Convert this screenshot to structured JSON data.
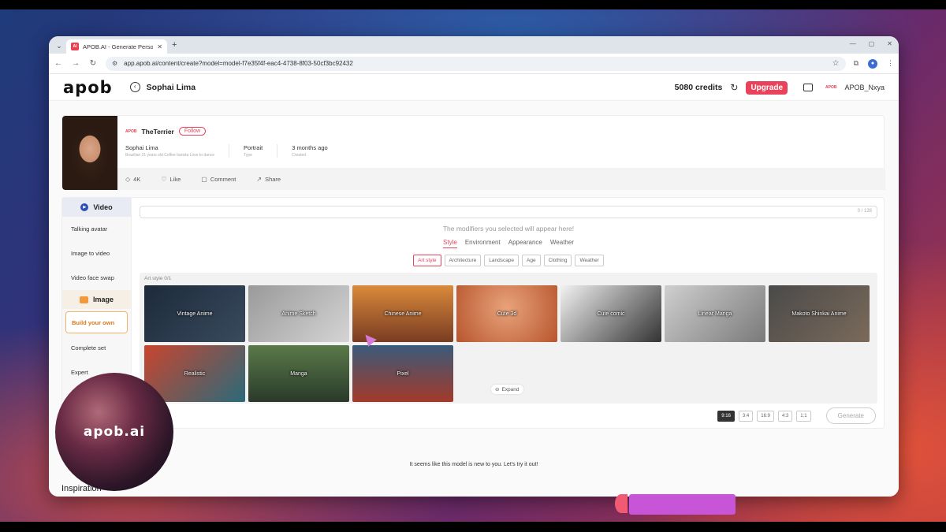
{
  "browser": {
    "tab_title": "APOB.AI - Generate Personaliz",
    "favicon_text": "AI",
    "url": "app.apob.ai/content/create?model=model-f7e35f4f-eac4-4738-8f03-50cf3bc92432"
  },
  "header": {
    "logo": "apob",
    "model_name": "Sophai Lima",
    "credits": "5080 credits",
    "upgrade_label": "Upgrade",
    "mini_logo": "APOB",
    "username": "APOB_Nxya"
  },
  "model_card": {
    "owner": "TheTerrier",
    "owner_logo": "APOB",
    "follow_label": "Follow",
    "meta": [
      {
        "value": "Sophai Lima",
        "key": "Brazilian 21 years old Coffee barista Love to dance"
      },
      {
        "value": "Portrait",
        "key": "Type"
      },
      {
        "value": "3 months ago",
        "key": "Created"
      }
    ],
    "actions": [
      {
        "icon": "diamond-icon",
        "glyph": "◇",
        "label": "4K"
      },
      {
        "icon": "heart-icon",
        "glyph": "♡",
        "label": "Like"
      },
      {
        "icon": "comment-icon",
        "glyph": "▢",
        "label": "Comment"
      },
      {
        "icon": "share-icon",
        "glyph": "↗",
        "label": "Share"
      }
    ]
  },
  "sidebar": {
    "video_heading": "Video",
    "video_items": [
      "Talking avatar",
      "Image to video",
      "Video face swap"
    ],
    "image_heading": "Image",
    "image_items": [
      "Build your own",
      "Complete set",
      "Expert"
    ]
  },
  "editor": {
    "prompt_count": "0 / 128",
    "hint": "The modifiers you selected will appear here!",
    "tabs": [
      "Style",
      "Environment",
      "Appearance",
      "Weather"
    ],
    "chips": [
      "Art style",
      "Architecture",
      "Landscape",
      "Age",
      "Clothing",
      "Weather"
    ],
    "grid_label": "Art style  0/1",
    "styles": [
      {
        "label": "Vintage Anime",
        "bg": "linear-gradient(135deg,#1c2a3a,#3a4a5e)"
      },
      {
        "label": "Anime Sketch",
        "bg": "linear-gradient(135deg,#9a9a9a,#d4d4d4)"
      },
      {
        "label": "Chinese Anime",
        "bg": "linear-gradient(180deg,#d98a3b,#7a3c22)"
      },
      {
        "label": "Cute 3d",
        "bg": "radial-gradient(circle at 50% 40%,#e8a37a,#b8552e)"
      },
      {
        "label": "Cute comic",
        "bg": "linear-gradient(135deg,#f2f2f2,#333)"
      },
      {
        "label": "Linear Manga",
        "bg": "linear-gradient(135deg,#cfcfcf,#7a7a7a)"
      },
      {
        "label": "Makoto Shinkai Anime",
        "bg": "linear-gradient(135deg,#4a4a4a,#7b6a5a)"
      },
      {
        "label": "Realistic",
        "bg": "linear-gradient(135deg,#c8452e,#2a6a7a)"
      },
      {
        "label": "Manga",
        "bg": "linear-gradient(180deg,#5a7a4a,#2a3a2a)"
      },
      {
        "label": "Pixel",
        "bg": "linear-gradient(180deg,#3a5a7a,#a33a2a)"
      }
    ],
    "expand_label": "Expand",
    "ratios": [
      "9:16",
      "3:4",
      "16:9",
      "4:3",
      "1:1"
    ],
    "generate_label": "Generate"
  },
  "new_message": "It seems like this model is new to you. Let's try it out!",
  "inspiration": "Inspiration",
  "brand_overlay": "apob.ai"
}
